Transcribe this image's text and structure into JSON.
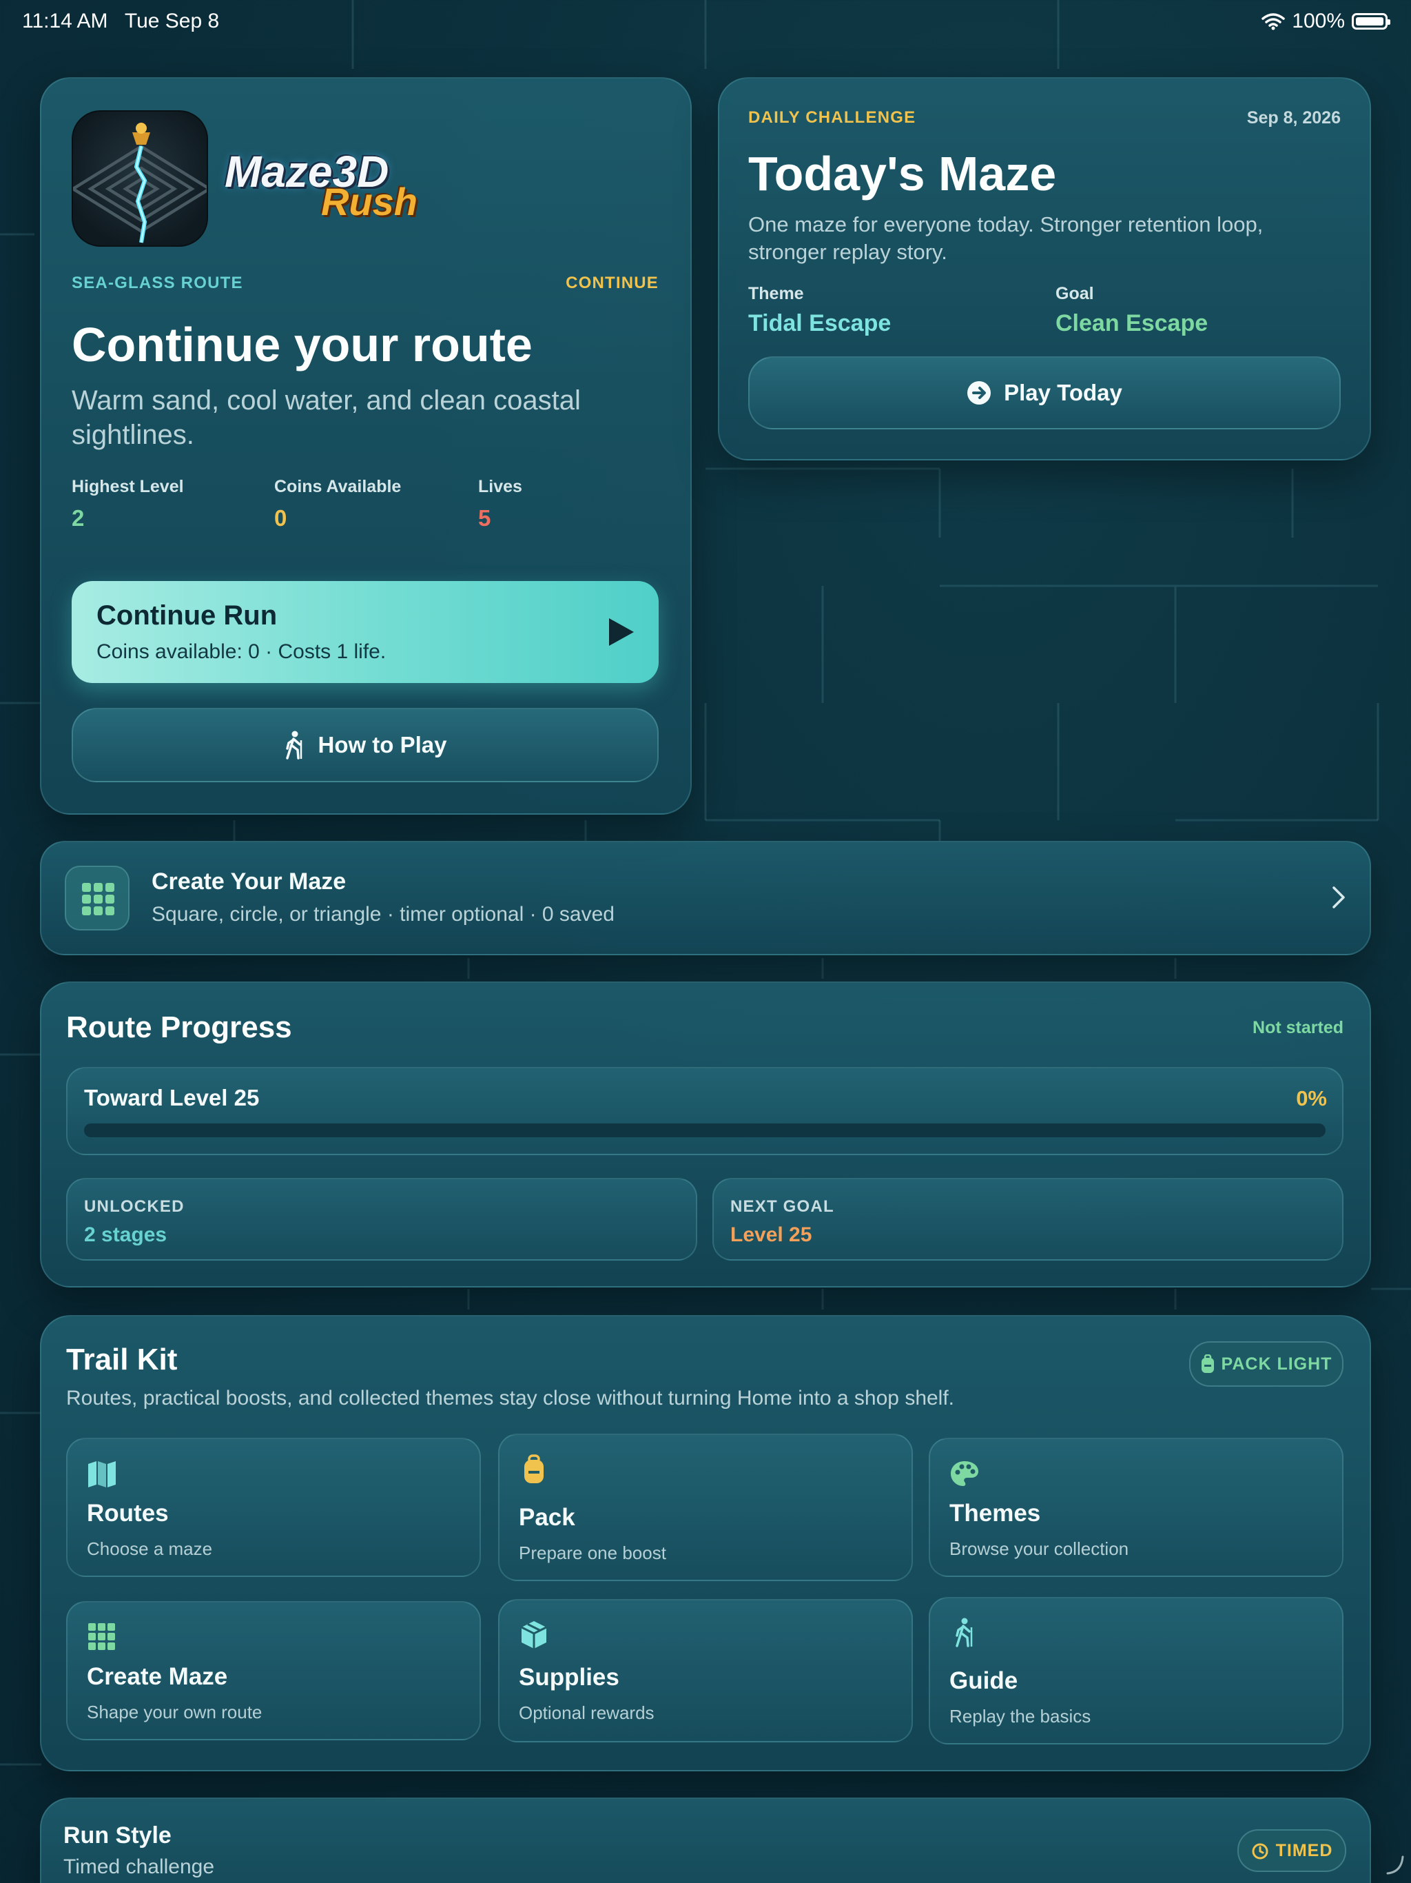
{
  "status_bar": {
    "time": "11:14 AM",
    "date": "Tue Sep 8",
    "battery": "100%"
  },
  "hero": {
    "logo_main": "Maze3D",
    "logo_sub": "Rush",
    "route_name": "SEA-GLASS ROUTE",
    "continue_tag": "CONTINUE",
    "title": "Continue your route",
    "subtitle": "Warm sand, cool water, and clean coastal sightlines.",
    "stats": [
      {
        "label": "Highest Level",
        "value": "2"
      },
      {
        "label": "Coins Available",
        "value": "0"
      },
      {
        "label": "Lives",
        "value": "5"
      }
    ],
    "continue_button": {
      "title": "Continue Run",
      "subtitle": "Coins available: 0 · Costs 1 life."
    },
    "how_to_play_label": "How to Play"
  },
  "daily": {
    "eyebrow": "DAILY CHALLENGE",
    "date": "Sep 8, 2026",
    "title": "Today's Maze",
    "description": "One maze for everyone today. Stronger retention loop, stronger replay story.",
    "theme_label": "Theme",
    "theme_value": "Tidal Escape",
    "goal_label": "Goal",
    "goal_value": "Clean Escape",
    "play_label": "Play Today"
  },
  "create_row": {
    "title": "Create Your Maze",
    "subtitle": "Square, circle, or triangle · timer optional · 0 saved"
  },
  "progress": {
    "title": "Route Progress",
    "status": "Not started",
    "bar_label": "Toward Level 25",
    "percent_label": "0%",
    "fraction": 0,
    "unlocked_label": "UNLOCKED",
    "unlocked_value": "2 stages",
    "next_goal_label": "NEXT GOAL",
    "next_goal_value": "Level 25"
  },
  "trail_kit": {
    "title": "Trail Kit",
    "badge": "PACK LIGHT",
    "description": "Routes, practical boosts, and collected themes stay close without turning Home into a shop shelf.",
    "tiles": [
      {
        "icon": "map-icon",
        "title": "Routes",
        "subtitle": "Choose a maze"
      },
      {
        "icon": "backpack-icon",
        "title": "Pack",
        "subtitle": "Prepare one boost"
      },
      {
        "icon": "palette-icon",
        "title": "Themes",
        "subtitle": "Browse your collection"
      },
      {
        "icon": "grid-icon",
        "title": "Create Maze",
        "subtitle": "Shape your own route"
      },
      {
        "icon": "box-icon",
        "title": "Supplies",
        "subtitle": "Optional rewards"
      },
      {
        "icon": "hiker-icon",
        "title": "Guide",
        "subtitle": "Replay the basics"
      }
    ]
  },
  "run_style": {
    "title": "Run Style",
    "subtitle": "Timed challenge",
    "badge": "TIMED"
  },
  "colors": {
    "accent_teal": "#67d2cf",
    "accent_gold": "#f0c24e",
    "accent_green": "#7ed8a2",
    "lives_red": "#ee6e60",
    "goal_orange": "#f2a05a",
    "continue_button": "#72dcd2"
  }
}
